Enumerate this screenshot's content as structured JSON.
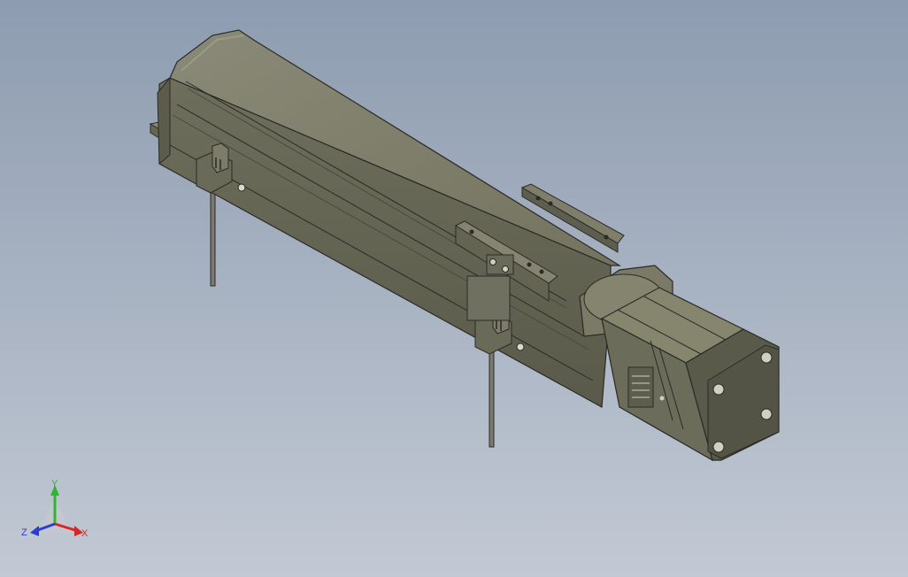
{
  "scene": {
    "background_top": "#8d9cb0",
    "background_bottom": "#c2c9d4",
    "part_color": "#7b7b6a",
    "part_edge": "#2a2a26"
  },
  "triad": {
    "x_label": "X",
    "y_label": "Y",
    "z_label": "Z",
    "x_color": "#d42828",
    "y_color": "#2fb52f",
    "z_color": "#2a3fd0"
  }
}
